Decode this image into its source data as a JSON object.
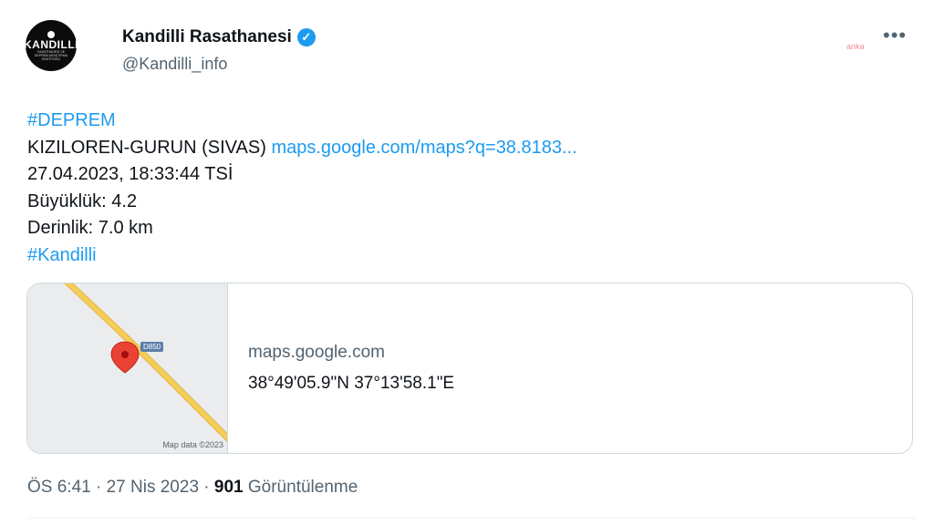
{
  "author": {
    "avatar_text": "KANDILLI",
    "avatar_subtext": "RASATHANESİ VE DEPREM ARAŞTIRMA ENSTİTÜSÜ",
    "display_name": "Kandilli Rasathanesi",
    "verified": "✓",
    "handle": "@Kandilli_info"
  },
  "watermark": "anka",
  "more_menu": "•••",
  "tweet": {
    "hashtag1": "#DEPREM",
    "location": "KIZILOREN-GURUN (SIVAS)",
    "map_link": "maps.google.com/maps?q=38.8183...",
    "datetime": "27.04.2023, 18:33:44 TSİ",
    "magnitude": "Büyüklük: 4.2",
    "depth": "Derinlik: 7.0 km",
    "hashtag2": "#Kandilli"
  },
  "card": {
    "road_label": "D850",
    "map_credit": "Map data ©2023",
    "domain": "maps.google.com",
    "coords": "38°49'05.9\"N 37°13'58.1\"E"
  },
  "meta": {
    "time": "ÖS 6:41",
    "separator1": " · ",
    "date": "27 Nis 2023",
    "separator2": " · ",
    "views_count": "901",
    "views_label": " Görüntülenme"
  },
  "colors": {
    "accent": "#1d9bf0",
    "road": "#f5cd5a",
    "pin": "#ea4335"
  }
}
